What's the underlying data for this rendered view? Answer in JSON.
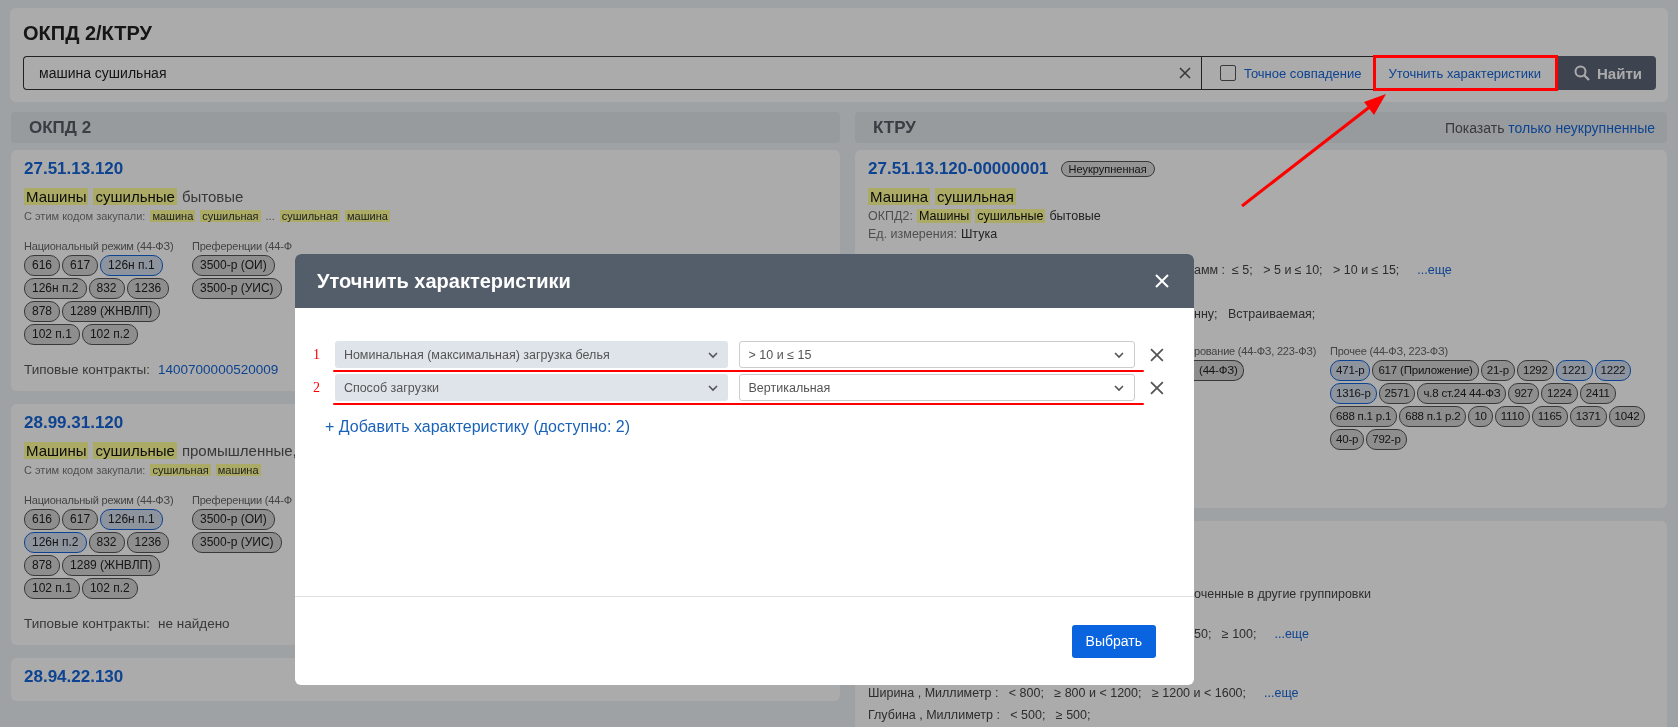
{
  "page": {
    "title": "ОКПД 2/КТРУ"
  },
  "search": {
    "value": "машина сушильная",
    "exact_match": {
      "label": "Точное совпадение",
      "checked": false
    },
    "refine_button": "Уточнить характеристики",
    "find_button": "Найти"
  },
  "okpd": {
    "heading": "ОКПД 2",
    "cards": [
      {
        "code": "27.51.13.120",
        "title": [
          {
            "text": "Машины",
            "highlighted": true
          },
          {
            "text": "сушильные",
            "highlighted": true
          },
          {
            "text": "бытовые",
            "highlighted": false
          }
        ],
        "purchased_label": "С этим кодом закупали:",
        "purchased": [
          {
            "text": "машина",
            "highlighted": true
          },
          {
            "text": "сушильная",
            "highlighted": true
          },
          {
            "text": "...",
            "highlighted": false
          },
          {
            "text": "сушильная",
            "highlighted": true
          },
          {
            "text": "машина",
            "highlighted": true
          }
        ],
        "groups": [
          {
            "label": "Национальный режим (44-ФЗ)",
            "chips": [
              {
                "text": "616",
                "accent": false
              },
              {
                "text": "617",
                "accent": false
              },
              {
                "text": "126н п.1",
                "accent": true
              },
              {
                "text": "126н п.2",
                "accent": false
              },
              {
                "text": "832",
                "accent": false
              },
              {
                "text": "1236",
                "accent": false
              },
              {
                "text": "878",
                "accent": false
              },
              {
                "text": "1289 (ЖНВЛП)",
                "accent": false
              },
              {
                "text": "102 п.1",
                "accent": false
              },
              {
                "text": "102 п.2",
                "accent": false
              }
            ]
          },
          {
            "label": "Преференции (44-Ф",
            "chips": [
              {
                "text": "3500-р (ОИ)",
                "accent": false
              },
              {
                "text": "3500-р (УИС)",
                "accent": false
              }
            ]
          }
        ],
        "contracts": {
          "label": "Типовые контракты:",
          "value": "1400700000520009",
          "kind": "link"
        }
      },
      {
        "code": "28.99.31.120",
        "title": [
          {
            "text": "Машины",
            "highlighted": true
          },
          {
            "text": "сушильные",
            "highlighted": true
          },
          {
            "text": "промышленные,",
            "highlighted": false
          }
        ],
        "purchased_label": "С этим кодом закупали:",
        "purchased": [
          {
            "text": "сушильная",
            "highlighted": true
          },
          {
            "text": "машина",
            "highlighted": true
          }
        ],
        "groups": [
          {
            "label": "Национальный режим (44-ФЗ)",
            "chips": [
              {
                "text": "616",
                "accent": false
              },
              {
                "text": "617",
                "accent": false
              },
              {
                "text": "126н п.1",
                "accent": true
              },
              {
                "text": "126н п.2",
                "accent": true
              },
              {
                "text": "832",
                "accent": false
              },
              {
                "text": "1236",
                "accent": false
              },
              {
                "text": "878",
                "accent": false
              },
              {
                "text": "1289 (ЖНВЛП)",
                "accent": false
              },
              {
                "text": "102 п.1",
                "accent": false
              },
              {
                "text": "102 п.2",
                "accent": false
              }
            ]
          },
          {
            "label": "Преференции (44-Ф",
            "chips": [
              {
                "text": "3500-р (ОИ)",
                "accent": false
              },
              {
                "text": "3500-р (УИС)",
                "accent": false
              }
            ]
          }
        ],
        "contracts": {
          "label": "Типовые контракты:",
          "value": "не найдено",
          "kind": "text"
        }
      },
      {
        "code": "28.94.22.130"
      }
    ]
  },
  "ktru": {
    "heading": "КТРУ",
    "filter_prefix": "Показать",
    "filter_link": "только неукрупненные",
    "cards": [
      {
        "code": "27.51.13.120-00000001",
        "badge": "Неукрупненная",
        "title": [
          {
            "text": "Машина",
            "highlighted": true
          },
          {
            "text": "сушильная",
            "highlighted": true
          }
        ],
        "okpd_label": "ОКПД2:",
        "okpd": [
          {
            "text": "Машины",
            "highlighted": true
          },
          {
            "text": "сушильные",
            "highlighted": true
          },
          {
            "text": "бытовые",
            "highlighted": false
          }
        ],
        "unit_label": "Ед. измерения:",
        "unit": "Штука",
        "lines": [
          {
            "text": "амм :  ≤ 5;   > 5 и ≤ 10;   > 10 и ≤ 15;",
            "more": "...еще",
            "cut": true
          },
          {
            "text": "нну;   Встраиваемая;",
            "cut": true
          }
        ],
        "groups": [
          {
            "label": "рование (44-ФЗ, 223-ФЗ)",
            "cut": true,
            "chips": [
              {
                "text": "(44-ФЗ)",
                "accent": false
              }
            ]
          },
          {
            "label": "Прочее (44-ФЗ, 223-ФЗ)",
            "cut": false,
            "chips": [
              {
                "text": "471-р",
                "accent": true
              },
              {
                "text": "617 (Приложение)",
                "accent": false
              },
              {
                "text": "21-р",
                "accent": false
              },
              {
                "text": "1292",
                "accent": false
              },
              {
                "text": "1221",
                "accent": true
              },
              {
                "text": "1222",
                "accent": true
              },
              {
                "text": "1316-р",
                "accent": true
              },
              {
                "text": "2571",
                "accent": false
              },
              {
                "text": "ч.8 ст.24 44-ФЗ",
                "accent": false
              },
              {
                "text": "927",
                "accent": false
              },
              {
                "text": "1224",
                "accent": false
              },
              {
                "text": "2411",
                "accent": false
              },
              {
                "text": "688 п.1 р.1",
                "accent": false
              },
              {
                "text": "688 п.1 р.2",
                "accent": false
              },
              {
                "text": "10",
                "accent": false
              },
              {
                "text": "1110",
                "accent": false
              },
              {
                "text": "1165",
                "accent": false
              },
              {
                "text": "1371",
                "accent": false
              },
              {
                "text": "1042",
                "accent": false
              },
              {
                "text": "40-р",
                "accent": false
              },
              {
                "text": "792-р",
                "accent": false
              }
            ]
          }
        ]
      },
      {
        "lines": [
          {
            "text": "оченные в другие группировки",
            "cut": true
          },
          {
            "text": "50;   ≥ 100;",
            "more": "...еще",
            "cut": true
          },
          {
            "text": "Ширина , Миллиметр :   < 800;   ≥ 800 и < 1200;   ≥ 1200 и < 1600;",
            "more": "...еще",
            "cut": false
          },
          {
            "text": "Глубина , Миллиметр :   < 500;   ≥ 500;",
            "cut": false
          }
        ]
      }
    ]
  },
  "modal": {
    "title": "Уточнить характеристики",
    "rows": [
      {
        "number": "1",
        "property": "Номинальная (максимальная) загрузка белья",
        "value": "> 10 и ≤ 15"
      },
      {
        "number": "2",
        "property": "Способ загрузки",
        "value": "Вертикальная"
      }
    ],
    "add_link": "+ Добавить характеристику (доступно: 2)",
    "submit": "Выбрать"
  }
}
